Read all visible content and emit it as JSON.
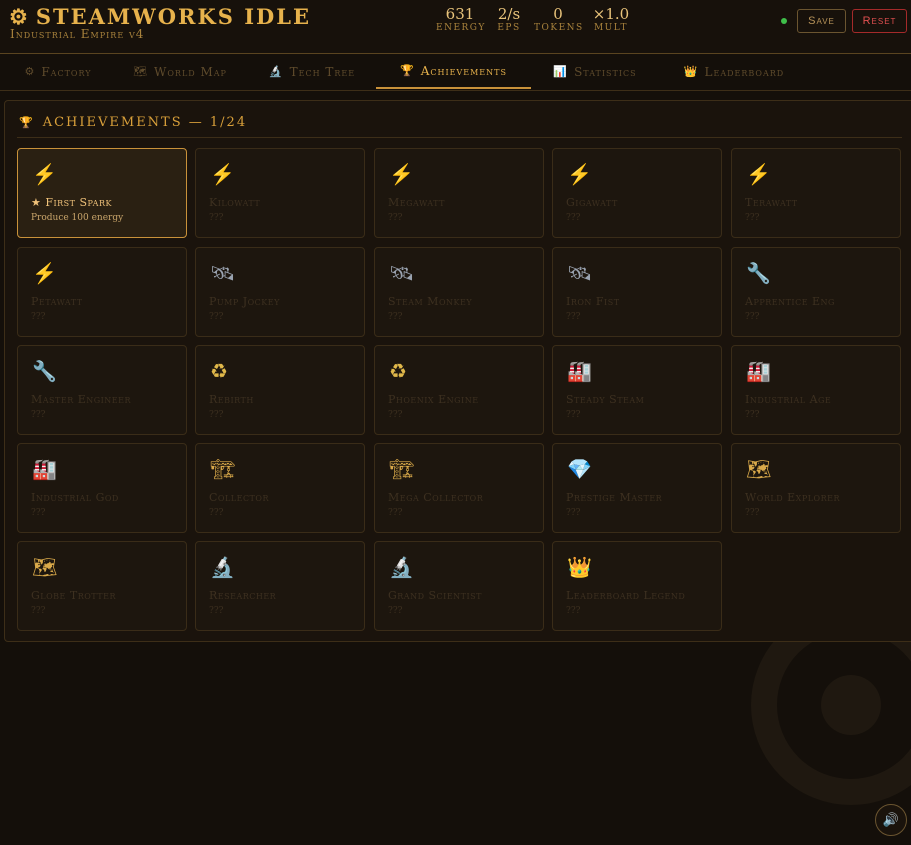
{
  "header": {
    "title": "Steamworks Idle",
    "subtitle": "Industrial Empire v4",
    "stats": [
      {
        "value": "631",
        "label": "Energy"
      },
      {
        "value": "2/s",
        "label": "EPS"
      },
      {
        "value": "0",
        "label": "Tokens"
      },
      {
        "value": "×1.0",
        "label": "Mult"
      }
    ],
    "save_label": "Save",
    "reset_label": "Reset"
  },
  "tabs": [
    {
      "label": "Factory",
      "icon": "⚙"
    },
    {
      "label": "World Map",
      "icon": "🗺"
    },
    {
      "label": "Tech Tree",
      "icon": "🔬"
    },
    {
      "label": "Achievements",
      "icon": "🏆"
    },
    {
      "label": "Statistics",
      "icon": "📊"
    },
    {
      "label": "Leaderboard",
      "icon": "👑"
    }
  ],
  "active_tab": "Achievements",
  "panel": {
    "title": "Achievements — 1/24",
    "icon": "🏆"
  },
  "achievements": [
    {
      "name": "★ First Spark",
      "desc": "Produce 100 energy",
      "icon": "⚡",
      "unlocked": true
    },
    {
      "name": "Kilowatt",
      "desc": "???",
      "icon": "⚡",
      "unlocked": false
    },
    {
      "name": "Megawatt",
      "desc": "???",
      "icon": "⚡",
      "unlocked": false
    },
    {
      "name": "Gigawatt",
      "desc": "???",
      "icon": "⚡",
      "unlocked": false
    },
    {
      "name": "Terawatt",
      "desc": "???",
      "icon": "⚡",
      "unlocked": false
    },
    {
      "name": "Petawatt",
      "desc": "???",
      "icon": "⚡",
      "unlocked": false
    },
    {
      "name": "Pump Jockey",
      "desc": "???",
      "icon": "🛰",
      "unlocked": false
    },
    {
      "name": "Steam Monkey",
      "desc": "???",
      "icon": "🛰",
      "unlocked": false
    },
    {
      "name": "Iron Fist",
      "desc": "???",
      "icon": "🛰",
      "unlocked": false
    },
    {
      "name": "Apprentice Eng",
      "desc": "???",
      "icon": "🔧",
      "unlocked": false
    },
    {
      "name": "Master Engineer",
      "desc": "???",
      "icon": "🔧",
      "unlocked": false
    },
    {
      "name": "Rebirth",
      "desc": "???",
      "icon": "♻",
      "unlocked": false
    },
    {
      "name": "Phoenix Engine",
      "desc": "???",
      "icon": "♻",
      "unlocked": false
    },
    {
      "name": "Steady Steam",
      "desc": "???",
      "icon": "🏭",
      "unlocked": false
    },
    {
      "name": "Industrial Age",
      "desc": "???",
      "icon": "🏭",
      "unlocked": false
    },
    {
      "name": "Industrial God",
      "desc": "???",
      "icon": "🏭",
      "unlocked": false
    },
    {
      "name": "Collector",
      "desc": "???",
      "icon": "🏗",
      "unlocked": false
    },
    {
      "name": "Mega Collector",
      "desc": "???",
      "icon": "🏗",
      "unlocked": false
    },
    {
      "name": "Prestige Master",
      "desc": "???",
      "icon": "💎",
      "unlocked": false
    },
    {
      "name": "World Explorer",
      "desc": "???",
      "icon": "🗺",
      "unlocked": false
    },
    {
      "name": "Globe Trotter",
      "desc": "???",
      "icon": "🗺",
      "unlocked": false
    },
    {
      "name": "Researcher",
      "desc": "???",
      "icon": "🔬",
      "unlocked": false
    },
    {
      "name": "Grand Scientist",
      "desc": "???",
      "icon": "🔬",
      "unlocked": false
    },
    {
      "name": "Leaderboard Legend",
      "desc": "???",
      "icon": "👑",
      "unlocked": false
    }
  ],
  "sound_icon": "🔊",
  "colors": {
    "accent": "#e7b24c",
    "reset": "#e05050",
    "online": "#3fbf4a"
  }
}
